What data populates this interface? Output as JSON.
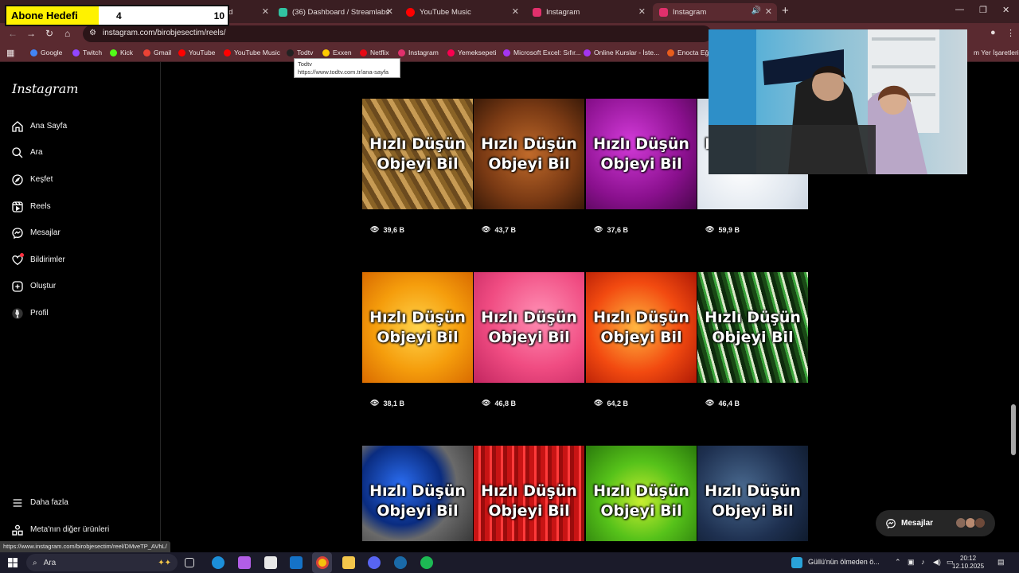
{
  "goal": {
    "label": "Abone Hedefi",
    "current": "4",
    "target": "10"
  },
  "tabs": [
    {
      "label": "rd",
      "color": "#5a2a30"
    },
    {
      "label": "(36) Dashboard / Streamlabs",
      "color": "#31c3a2"
    },
    {
      "label": "YouTube Music",
      "color": "#ff0000"
    },
    {
      "label": "Instagram",
      "color": "#e1306c"
    },
    {
      "label": "Instagram",
      "color": "#e1306c"
    }
  ],
  "url": "instagram.com/birobjesectim/reels/",
  "bookmarks": [
    {
      "label": "Google",
      "color": "#4285f4"
    },
    {
      "label": "Twitch",
      "color": "#9146ff"
    },
    {
      "label": "Kick",
      "color": "#53fc18"
    },
    {
      "label": "Gmail",
      "color": "#ea4335"
    },
    {
      "label": "YouTube",
      "color": "#ff0000"
    },
    {
      "label": "YouTube Music",
      "color": "#ff0000"
    },
    {
      "label": "Todtv",
      "color": "#222222"
    },
    {
      "label": "Exxen",
      "color": "#ffcc00"
    },
    {
      "label": "Netflix",
      "color": "#e50914"
    },
    {
      "label": "Instagram",
      "color": "#e1306c"
    },
    {
      "label": "Yemeksepeti",
      "color": "#fa0050"
    },
    {
      "label": "Microsoft Excel: Sıfır...",
      "color": "#a435f0"
    },
    {
      "label": "Online Kurslar - İste...",
      "color": "#a435f0"
    },
    {
      "label": "Enocta Eğiti",
      "color": "#e85d1c"
    },
    {
      "label": "m Yer İşaretleri",
      "color": "#5a2a30"
    }
  ],
  "tooltip": {
    "title": "Todtv",
    "url": "https://www.todtv.com.tr/ana-sayfa"
  },
  "sidebar": {
    "logo": "Instagram",
    "items": [
      {
        "label": "Ana Sayfa",
        "icon": "home-icon"
      },
      {
        "label": "Ara",
        "icon": "search-icon"
      },
      {
        "label": "Keşfet",
        "icon": "compass-icon"
      },
      {
        "label": "Reels",
        "icon": "reels-icon"
      },
      {
        "label": "Mesajlar",
        "icon": "messenger-icon"
      },
      {
        "label": "Bildirimler",
        "icon": "heart-icon"
      },
      {
        "label": "Oluştur",
        "icon": "plus-square-icon"
      },
      {
        "label": "Profil",
        "icon": "avatar-icon"
      }
    ],
    "bottom": [
      {
        "label": "Daha fazla",
        "icon": "menu-icon"
      },
      {
        "label": "Meta'nın diğer ürünleri",
        "icon": "grid-icon"
      }
    ]
  },
  "reels": {
    "title_line1": "Hızlı Düşün",
    "title_line2": "Objeyi Bil",
    "items": [
      {
        "views": "39,6 B",
        "theme": "rope"
      },
      {
        "views": "43,7 B",
        "theme": "leather"
      },
      {
        "views": "37,6 B",
        "theme": "magenta"
      },
      {
        "views": "59,9 B",
        "theme": "snow"
      },
      {
        "views": "38,1 B",
        "theme": "orange"
      },
      {
        "views": "46,8 B",
        "theme": "pink"
      },
      {
        "views": "64,2 B",
        "theme": "fire"
      },
      {
        "views": "46,4 B",
        "theme": "grass"
      },
      {
        "views": "",
        "theme": "marble"
      },
      {
        "views": "",
        "theme": "knit"
      },
      {
        "views": "",
        "theme": "melon"
      },
      {
        "views": "",
        "theme": "shoe"
      }
    ]
  },
  "messages_pill": {
    "label": "Mesajlar"
  },
  "status_url": "https://www.instagram.com/birobjesectim/reel/DMveTP_AVhL/",
  "taskbar": {
    "search_label": "Ara",
    "weather": "Güllü'nün ölmeden ö...",
    "time": "20:12",
    "date": "12.10.2025"
  }
}
